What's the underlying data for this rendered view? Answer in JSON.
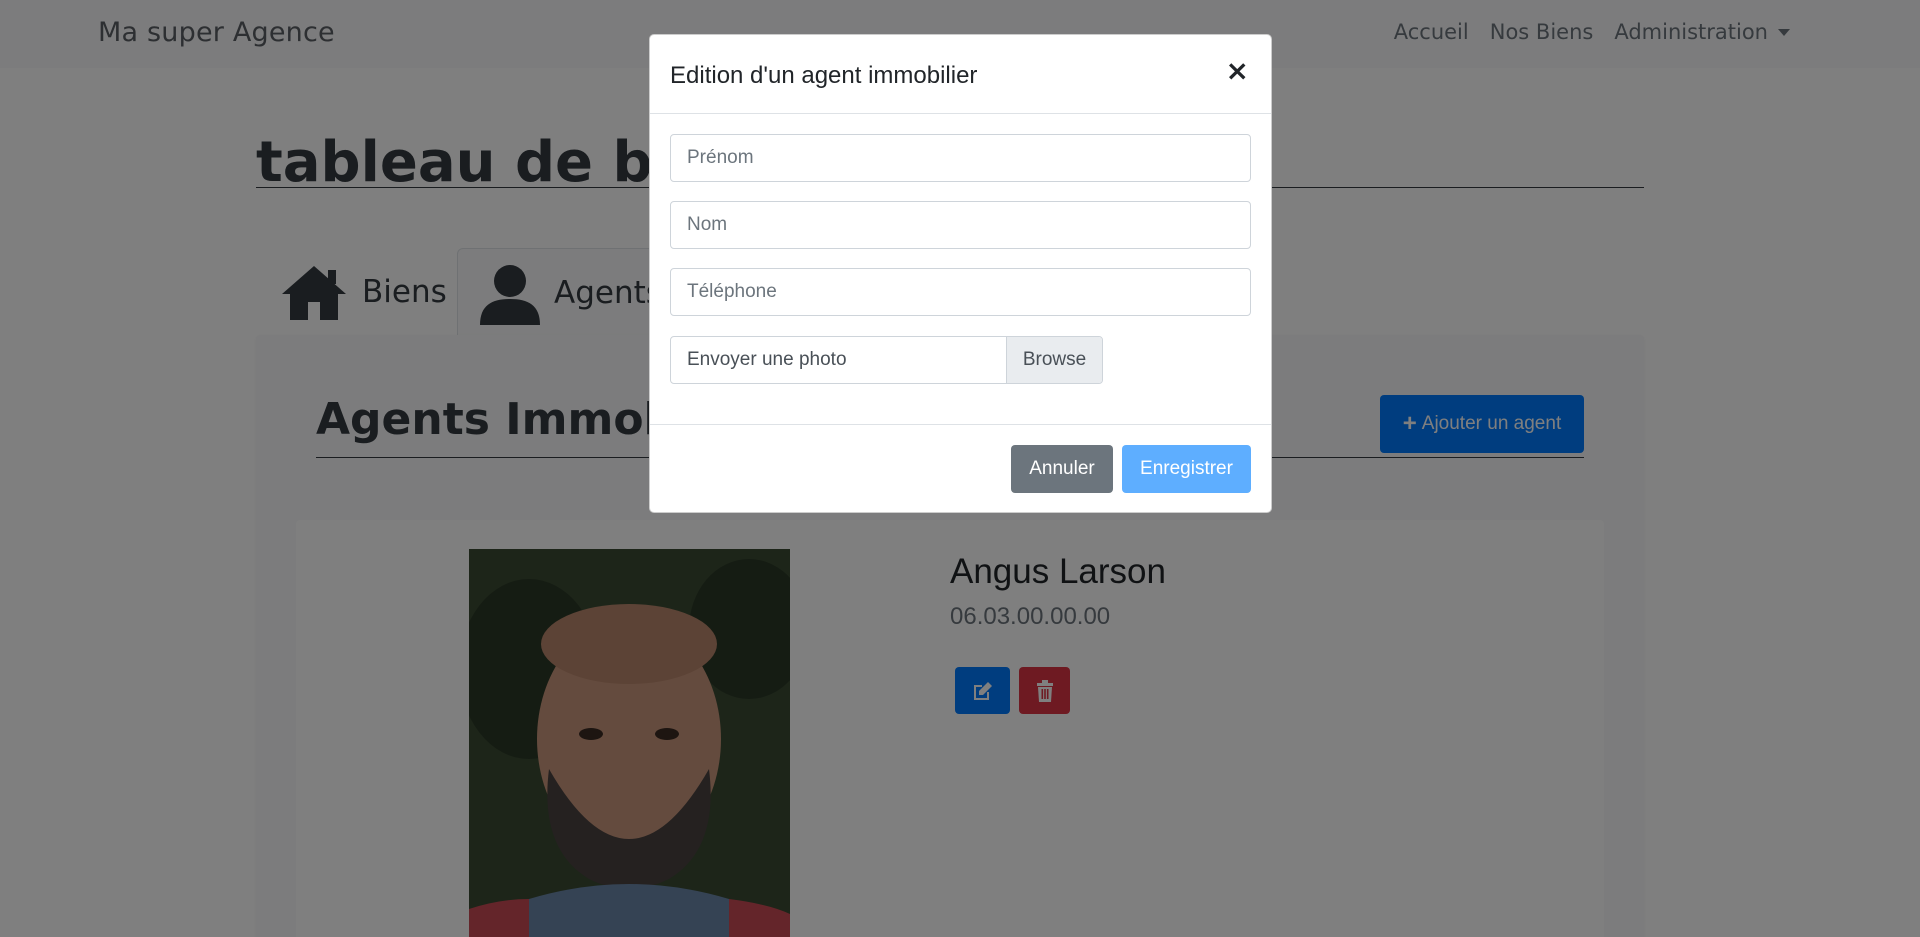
{
  "navbar": {
    "brand": "Ma super Agence",
    "links": [
      "Accueil",
      "Nos Biens",
      "Administration"
    ]
  },
  "page": {
    "title": "tableau de bord",
    "tabs": [
      {
        "label": "Biens",
        "icon": "home-icon"
      },
      {
        "label": "Agents",
        "icon": "user-icon"
      }
    ]
  },
  "agents": {
    "section_title": "Agents Immobiliers",
    "add_button": "Ajouter un agent",
    "list": [
      {
        "name": "Angus Larson",
        "phone": "06.03.00.00.00"
      }
    ]
  },
  "modal": {
    "title": "Edition d'un agent immobilier",
    "close": "×",
    "fields": {
      "prenom_placeholder": "Prénom",
      "nom_placeholder": "Nom",
      "telephone_placeholder": "Téléphone"
    },
    "file": {
      "label": "Envoyer une photo",
      "browse": "Browse"
    },
    "cancel": "Annuler",
    "save": "Enregistrer"
  },
  "colors": {
    "primary": "#007bff",
    "danger": "#dc3545",
    "secondary": "#6c757d",
    "save_disabled": "#5eaeff"
  }
}
